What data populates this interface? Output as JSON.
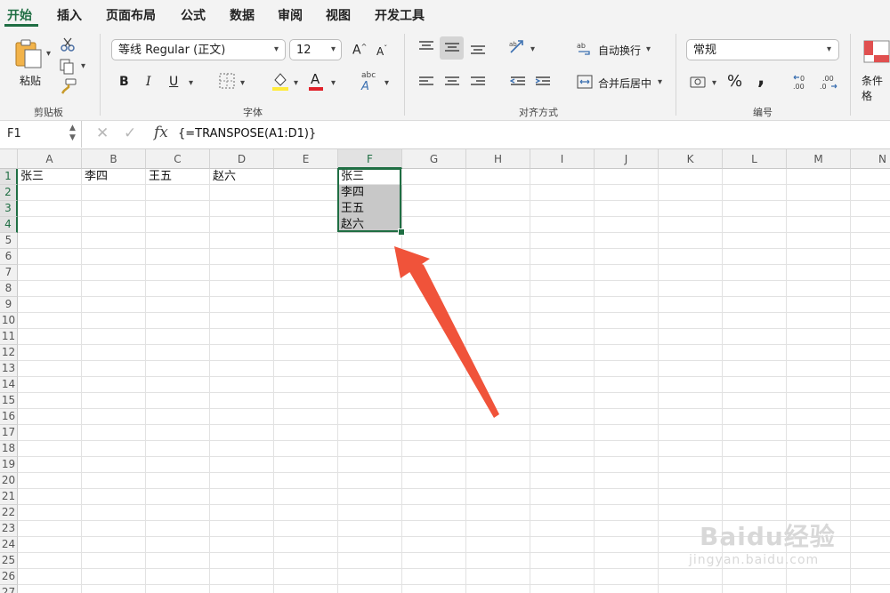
{
  "tabs": [
    "开始",
    "插入",
    "页面布局",
    "公式",
    "数据",
    "审阅",
    "视图",
    "开发工具"
  ],
  "ribbon": {
    "clipboard": {
      "paste_label": "粘贴",
      "group_label": "剪贴板"
    },
    "font": {
      "font_name": "等线 Regular (正文)",
      "font_size": "12",
      "group_label": "字体",
      "bold": "B",
      "italic": "I",
      "underline": "U"
    },
    "alignment": {
      "wrap_label": "自动换行",
      "merge_label": "合并后居中",
      "group_label": "对齐方式"
    },
    "number": {
      "format": "常规",
      "percent": "%",
      "comma": ",",
      "inc_decimal": ".00",
      "group_label": "编号"
    },
    "styles": {
      "cond_label": "条件格"
    }
  },
  "formula_bar": {
    "name_box": "F1",
    "fx": "fx",
    "formula": "{=TRANSPOSE(A1:D1)}"
  },
  "columns": [
    "A",
    "B",
    "C",
    "D",
    "E",
    "F",
    "G",
    "H",
    "I",
    "J",
    "K",
    "L",
    "M",
    "N"
  ],
  "cells": {
    "A1": "张三",
    "B1": "李四",
    "C1": "王五",
    "D1": "赵六",
    "F1": "张三",
    "F2": "李四",
    "F3": "王五",
    "F4": "赵六"
  },
  "colors": {
    "accent": "#1f6e43",
    "arrow": "#f0533a",
    "selection_fill": "#c8c8c8"
  },
  "watermark": {
    "brand": "Baidu经验",
    "url": "jingyan.baidu.com"
  }
}
